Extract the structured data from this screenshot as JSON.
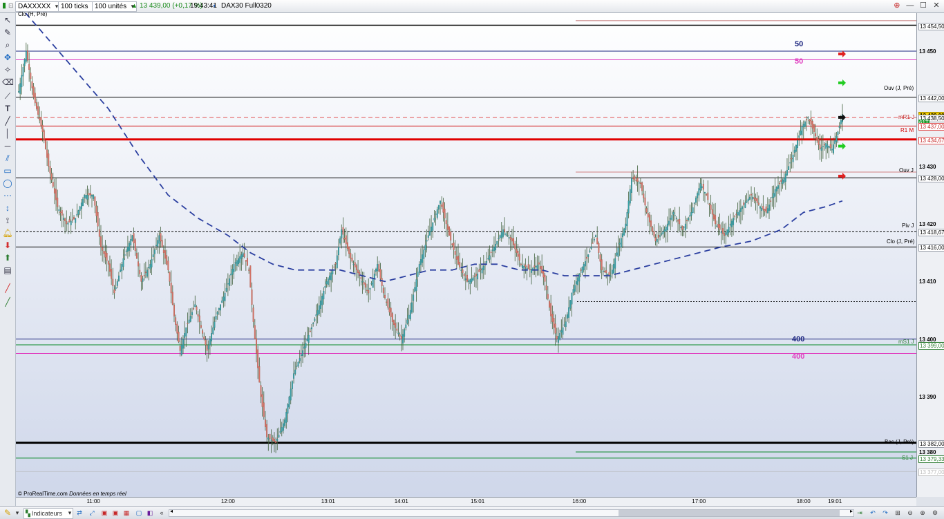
{
  "toolbar": {
    "instrument": "DAXXXXX",
    "timeframe": "100 ticks",
    "units": "100 unités",
    "price": "13 439,00 (+0,17 %)",
    "time": "19:43:41",
    "contract": "DAX30 Full0320"
  },
  "footer": {
    "credit": "© ProRealTime.com",
    "realtime": "Données en temps réel",
    "indicators_label": "Indicateurs"
  },
  "top_label": "Clo (H, Pré)",
  "line_labels": {
    "ouv_j_pre": "Ouv (J, Pré)",
    "mr1": "mR1 J",
    "r1": "R1 M",
    "ouv_j": "Ouv J",
    "piv_j": "Piv J",
    "clo_j_pre": "Clo (J, Pré)",
    "ms1": "mS1 J",
    "bas_j_pre": "Bas (J, Pré)",
    "s1": "S1 J",
    "ma50_blue": "50",
    "ma50_pink": "50",
    "ma400_blue": "400",
    "ma400_pink": "400"
  },
  "price_axis": [
    {
      "text": "13 454,50",
      "value": 13454.5,
      "kind": "box"
    },
    {
      "text": "13 450",
      "value": 13450,
      "kind": "tick"
    },
    {
      "text": "13 442,00",
      "value": 13442,
      "kind": "box"
    },
    {
      "text": "13 439,00",
      "value": 13439,
      "kind": "current"
    },
    {
      "text": "13 438,50",
      "value": 13438.5,
      "kind": "box"
    },
    {
      "text": "61T",
      "value": 13437.7,
      "kind": "green"
    },
    {
      "text": "13 437,00",
      "value": 13437,
      "kind": "redbox"
    },
    {
      "text": "13 434,67",
      "value": 13434.67,
      "kind": "redbox"
    },
    {
      "text": "13 430",
      "value": 13430,
      "kind": "tick"
    },
    {
      "text": "13 428,00",
      "value": 13428,
      "kind": "box"
    },
    {
      "text": "13 420",
      "value": 13420,
      "kind": "tick"
    },
    {
      "text": "13 418,67",
      "value": 13418.67,
      "kind": "box"
    },
    {
      "text": "13 416,00",
      "value": 13416,
      "kind": "box"
    },
    {
      "text": "13 410",
      "value": 13410,
      "kind": "tick"
    },
    {
      "text": "13 400",
      "value": 13400,
      "kind": "tick"
    },
    {
      "text": "13 399,00",
      "value": 13399,
      "kind": "greenbox"
    },
    {
      "text": "13 390",
      "value": 13390,
      "kind": "tick"
    },
    {
      "text": "13 382,00",
      "value": 13382,
      "kind": "box"
    },
    {
      "text": "13 380",
      "value": 13380.4,
      "kind": "tick"
    },
    {
      "text": "13 379,33",
      "value": 13379.33,
      "kind": "greenbox"
    },
    {
      "text": "13 377,00",
      "value": 13377,
      "kind": "greybox"
    }
  ],
  "time_axis": [
    {
      "text": "11:00",
      "idx": 50
    },
    {
      "text": "12:00",
      "idx": 140
    },
    {
      "text": "13:01",
      "idx": 207
    },
    {
      "text": "14:01",
      "idx": 256
    },
    {
      "text": "15:01",
      "idx": 307
    },
    {
      "text": "16:00",
      "idx": 375
    },
    {
      "text": "17:00",
      "idx": 455
    },
    {
      "text": "18:00",
      "idx": 525
    },
    {
      "text": "19:01",
      "idx": 546
    }
  ],
  "chart_data": {
    "type": "candlestick",
    "ylim": [
      13375,
      13456
    ],
    "levels": [
      {
        "name": "Clo (H, Pré)",
        "value": 13454.5,
        "color": "#000000"
      },
      {
        "name": "Ouv (J, Pré)",
        "value": 13442,
        "color": "#000000"
      },
      {
        "name": "mR1 J",
        "value": 13437,
        "color": "#d01010"
      },
      {
        "name": "R1 M",
        "value": 13434.67,
        "color": "#e00000"
      },
      {
        "name": "Ouv J",
        "value": 13428,
        "color": "#000000"
      },
      {
        "name": "Piv J",
        "value": 13418.67,
        "color": "#000000"
      },
      {
        "name": "Clo (J, Pré)",
        "value": 13416,
        "color": "#000000"
      },
      {
        "name": "mS1 J",
        "value": 13399,
        "color": "#0a8a2a"
      },
      {
        "name": "Bas (J, Pré)",
        "value": 13382,
        "color": "#000000"
      },
      {
        "name": "S1 J",
        "value": 13379.33,
        "color": "#0a8a2a"
      },
      {
        "name": "MA 50",
        "value": 13450,
        "color": "#1a237e"
      },
      {
        "name": "MA 50",
        "value": 13448.5,
        "color": "#e040c0"
      },
      {
        "name": "MA 400",
        "value": 13400,
        "color": "#1a237e"
      },
      {
        "name": "MA 400",
        "value": 13397.5,
        "color": "#e040c0"
      }
    ],
    "price_path": [
      [
        0,
        13443
      ],
      [
        5,
        13450
      ],
      [
        10,
        13442
      ],
      [
        16,
        13436
      ],
      [
        20,
        13430
      ],
      [
        26,
        13423
      ],
      [
        32,
        13420
      ],
      [
        38,
        13421
      ],
      [
        44,
        13425
      ],
      [
        50,
        13425
      ],
      [
        55,
        13416
      ],
      [
        60,
        13413
      ],
      [
        64,
        13408
      ],
      [
        70,
        13414
      ],
      [
        76,
        13418
      ],
      [
        82,
        13410
      ],
      [
        88,
        13413
      ],
      [
        94,
        13418
      ],
      [
        100,
        13412
      ],
      [
        104,
        13404
      ],
      [
        108,
        13398
      ],
      [
        112,
        13402
      ],
      [
        118,
        13406
      ],
      [
        122,
        13402
      ],
      [
        126,
        13398
      ],
      [
        132,
        13404
      ],
      [
        138,
        13408
      ],
      [
        144,
        13413
      ],
      [
        150,
        13415
      ],
      [
        154,
        13412
      ],
      [
        158,
        13400
      ],
      [
        162,
        13390
      ],
      [
        166,
        13383
      ],
      [
        172,
        13382
      ],
      [
        178,
        13386
      ],
      [
        184,
        13394
      ],
      [
        190,
        13398
      ],
      [
        196,
        13402
      ],
      [
        200,
        13405
      ],
      [
        206,
        13410
      ],
      [
        212,
        13413
      ],
      [
        216,
        13419
      ],
      [
        222,
        13414
      ],
      [
        228,
        13411
      ],
      [
        234,
        13408
      ],
      [
        240,
        13413
      ],
      [
        244,
        13408
      ],
      [
        250,
        13403
      ],
      [
        256,
        13400
      ],
      [
        262,
        13405
      ],
      [
        268,
        13413
      ],
      [
        274,
        13418
      ],
      [
        282,
        13424
      ],
      [
        288,
        13418
      ],
      [
        294,
        13413
      ],
      [
        300,
        13410
      ],
      [
        306,
        13411
      ],
      [
        312,
        13413
      ],
      [
        318,
        13416
      ],
      [
        324,
        13419
      ],
      [
        330,
        13417
      ],
      [
        336,
        13413
      ],
      [
        342,
        13412
      ],
      [
        348,
        13413
      ],
      [
        352,
        13410
      ],
      [
        356,
        13404
      ],
      [
        360,
        13400
      ],
      [
        366,
        13403
      ],
      [
        370,
        13408
      ],
      [
        376,
        13412
      ],
      [
        380,
        13414
      ],
      [
        386,
        13418
      ],
      [
        390,
        13412
      ],
      [
        396,
        13411
      ],
      [
        400,
        13415
      ],
      [
        406,
        13420
      ],
      [
        410,
        13428
      ],
      [
        416,
        13427
      ],
      [
        420,
        13422
      ],
      [
        426,
        13417
      ],
      [
        432,
        13419
      ],
      [
        438,
        13422
      ],
      [
        444,
        13419
      ],
      [
        450,
        13422
      ],
      [
        456,
        13427
      ],
      [
        460,
        13425
      ],
      [
        466,
        13420
      ],
      [
        472,
        13418
      ],
      [
        478,
        13421
      ],
      [
        484,
        13423
      ],
      [
        490,
        13425
      ],
      [
        496,
        13423
      ],
      [
        500,
        13422
      ],
      [
        506,
        13426
      ],
      [
        512,
        13428
      ],
      [
        518,
        13432
      ],
      [
        524,
        13437
      ],
      [
        528,
        13438.5
      ],
      [
        532,
        13436
      ],
      [
        536,
        13433
      ],
      [
        540,
        13434
      ],
      [
        544,
        13433
      ],
      [
        548,
        13436
      ],
      [
        551,
        13439
      ]
    ],
    "ma_blue_dashed": [
      [
        0,
        13458
      ],
      [
        20,
        13452
      ],
      [
        40,
        13446
      ],
      [
        60,
        13440
      ],
      [
        80,
        13432
      ],
      [
        100,
        13425
      ],
      [
        120,
        13421
      ],
      [
        140,
        13418
      ],
      [
        155,
        13415
      ],
      [
        170,
        13413
      ],
      [
        185,
        13412
      ],
      [
        200,
        13412
      ],
      [
        215,
        13412
      ],
      [
        230,
        13411
      ],
      [
        245,
        13410
      ],
      [
        260,
        13411
      ],
      [
        275,
        13412
      ],
      [
        290,
        13412
      ],
      [
        305,
        13413
      ],
      [
        320,
        13413
      ],
      [
        335,
        13412
      ],
      [
        350,
        13412
      ],
      [
        365,
        13411
      ],
      [
        380,
        13411
      ],
      [
        395,
        13411
      ],
      [
        410,
        13412
      ],
      [
        425,
        13413
      ],
      [
        440,
        13414
      ],
      [
        455,
        13415
      ],
      [
        470,
        13416
      ],
      [
        490,
        13417
      ],
      [
        510,
        13419
      ],
      [
        525,
        13422
      ],
      [
        540,
        13423
      ],
      [
        551,
        13424
      ]
    ]
  }
}
